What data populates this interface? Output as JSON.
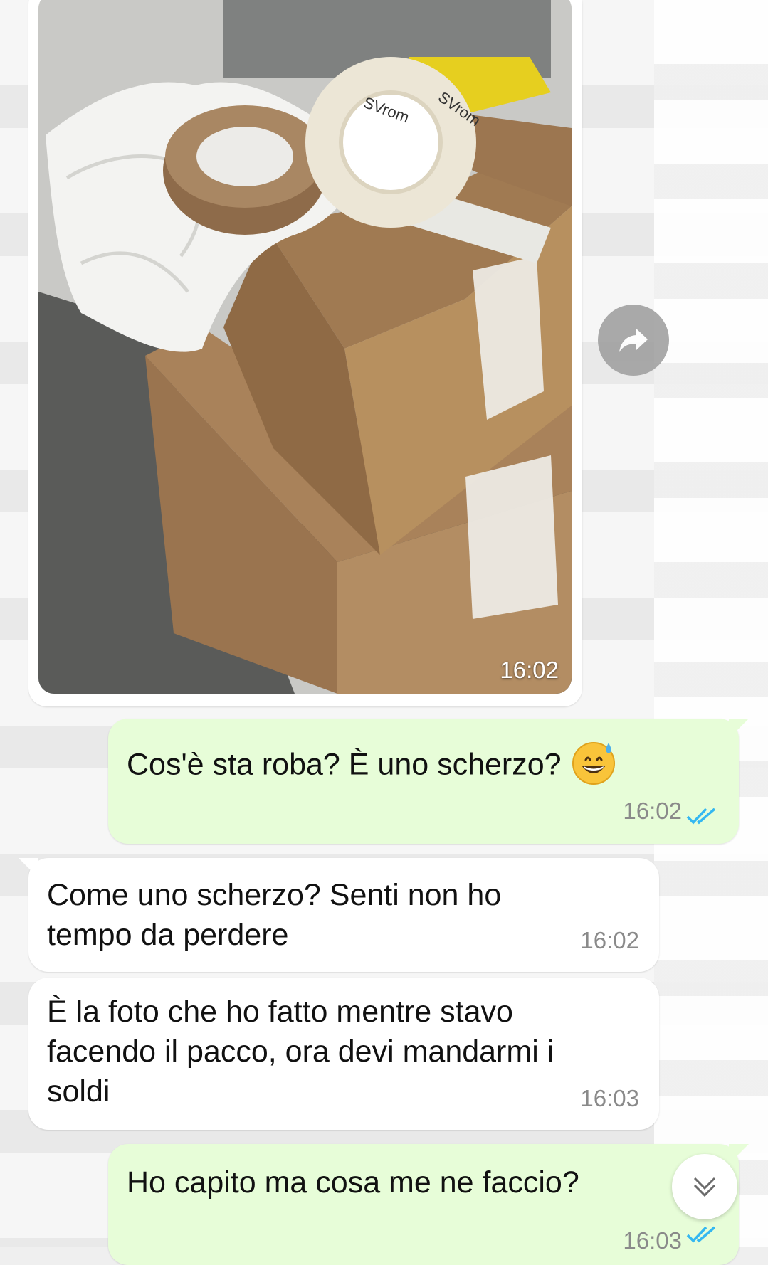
{
  "messages": [
    {
      "type": "image",
      "direction": "received",
      "time": "16:02"
    },
    {
      "type": "text",
      "direction": "sent",
      "text": "Cos'è sta roba? È uno scherzo?",
      "emoji": "grinning-sweat-emoji",
      "time": "16:02",
      "status": "read"
    },
    {
      "type": "text",
      "direction": "received",
      "lines": [
        "Come uno scherzo? Senti non ho",
        "tempo da perdere"
      ],
      "time": "16:02"
    },
    {
      "type": "text",
      "direction": "received",
      "lines": [
        "È la foto che ho fatto mentre stavo",
        "facendo il pacco, ora devi mandarmi i",
        "soldi"
      ],
      "time": "16:03"
    },
    {
      "type": "text",
      "direction": "sent",
      "text": "Ho capito ma cosa me ne faccio?",
      "time": "16:03",
      "status": "read"
    }
  ],
  "icons": {
    "forward": "forward-arrow-icon",
    "scroll": "chevron-double-down-icon",
    "read": "double-check-icon"
  },
  "colors": {
    "sent_bubble": "#e7fdd8",
    "received_bubble": "#ffffff",
    "read_ticks": "#34b7f1",
    "time_text": "#8a8a8a"
  },
  "photo_tape_text": "SVrom"
}
